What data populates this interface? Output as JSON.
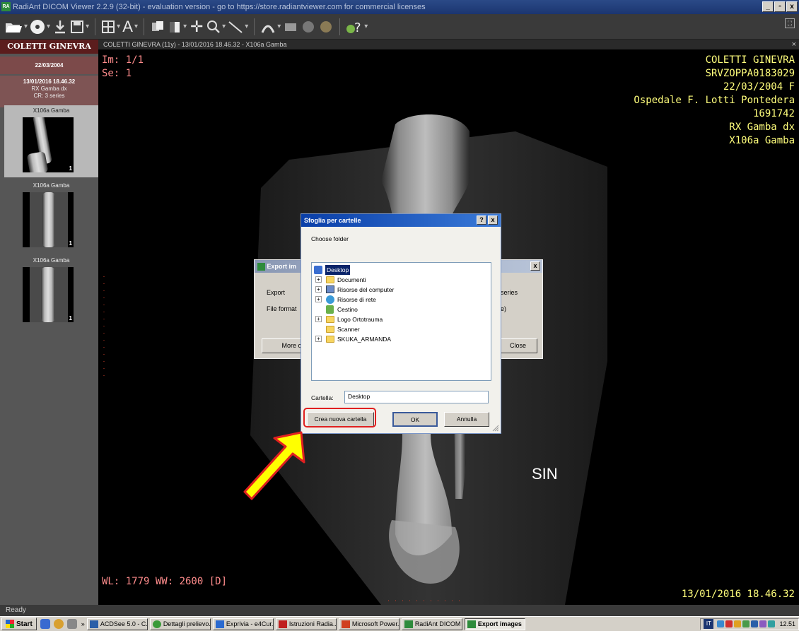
{
  "window": {
    "title": "RadiAnt DICOM Viewer 2.2.9 (32-bit) - evaluation version - go to https://store.radiantviewer.com for commercial licenses",
    "app_icon": "RA",
    "min": "_",
    "max": "▫",
    "close": "x"
  },
  "toolbar": {
    "icons": [
      "open-folder-icon",
      "cd-dvd-icon",
      "download-icon",
      "save-icon",
      "layout-grid-icon",
      "annotation-text-icon",
      "series-sync-icon",
      "window-level-icon",
      "crosshair-icon",
      "zoom-icon",
      "measure-line-icon",
      "3d-icon",
      "cine-icon",
      "mpr-icon",
      "info-icon",
      "toolbar-separator",
      "help-icon"
    ]
  },
  "sidebar": {
    "patient_name": "COLETTI GINEVRA",
    "birth_date": "22/03/2004",
    "study": {
      "datetime": "13/01/2016 18.46.32",
      "description": "RX Gamba dx",
      "info": "CR: 3 series"
    },
    "series": [
      {
        "label": "X106a Gamba",
        "count": "1"
      },
      {
        "label": "X106a Gamba",
        "count": "1"
      },
      {
        "label": "X106a Gamba",
        "count": "1"
      }
    ]
  },
  "viewer": {
    "header": "COLETTI GINEVRA (11y) - 13/01/2016 18.46.32 - X106a Gamba",
    "close": "×",
    "top_left": {
      "image": "Im: 1/1",
      "series": "Se: 1"
    },
    "top_right": [
      "COLETTI GINEVRA",
      "SRVZOPPA0183029",
      "22/03/2004 F",
      "Ospedale F. Lotti Pontedera",
      "1691742",
      "RX Gamba dx",
      "X106a Gamba"
    ],
    "bottom_left": "WL: 1779 WW: 2600 [D]",
    "bottom_right": "13/01/2016 18.46.32",
    "marker": "SIN"
  },
  "export_dialog": {
    "title": "Export im",
    "export_label": "Export",
    "format_label": "File format",
    "series_text": "series",
    "paren_text": "e)",
    "more_button": "More op",
    "close_button": "Close",
    "close_icon": "x"
  },
  "browse_dialog": {
    "title": "Sfoglia per cartelle",
    "help_btn": "?",
    "close_btn": "x",
    "prompt": "Choose folder",
    "tree": [
      {
        "label": "Desktop",
        "level": 0,
        "expander": "",
        "icon": "desktop-icon",
        "selected": true
      },
      {
        "label": "Documenti",
        "level": 1,
        "expander": "+",
        "icon": "documents-folder-icon"
      },
      {
        "label": "Risorse del computer",
        "level": 1,
        "expander": "+",
        "icon": "my-computer-icon"
      },
      {
        "label": "Risorse di rete",
        "level": 1,
        "expander": "+",
        "icon": "network-icon"
      },
      {
        "label": "Cestino",
        "level": 1,
        "expander": "",
        "icon": "recycle-bin-icon"
      },
      {
        "label": "Logo Ortotrauma",
        "level": 1,
        "expander": "+",
        "icon": "folder-icon"
      },
      {
        "label": "Scanner",
        "level": 1,
        "expander": "",
        "icon": "folder-icon"
      },
      {
        "label": "SKUKA_ARMANDA",
        "level": 1,
        "expander": "+",
        "icon": "folder-icon"
      }
    ],
    "folder_label": "Cartella:",
    "folder_value": "Desktop",
    "new_folder_button": "Crea nuova cartella",
    "ok_button": "OK",
    "cancel_button": "Annulla"
  },
  "annotation": {
    "arrow_color": "#ffff00",
    "highlight_color": "#e02020"
  },
  "status": {
    "text": "Ready"
  },
  "taskbar": {
    "start": "Start",
    "chevron": "»",
    "tasks": [
      {
        "label": "ACDSee 5.0 - C...",
        "icon_color": "#2a5fa8"
      },
      {
        "label": "Dettagli prelievo...",
        "icon_color": "#3a9a3a"
      },
      {
        "label": "Exprivia - e4Cur...",
        "icon_color": "#2a6ad0"
      },
      {
        "label": "Istruzioni Radia...",
        "icon_color": "#c02020"
      },
      {
        "label": "Microsoft Power...",
        "icon_color": "#d04020"
      },
      {
        "label": "RadiAnt DICOM ...",
        "icon_color": "#2e8b3c"
      },
      {
        "label": "Export images",
        "icon_color": "#2e8b3c",
        "active": true
      }
    ],
    "lang": "IT",
    "clock": "12.51"
  }
}
